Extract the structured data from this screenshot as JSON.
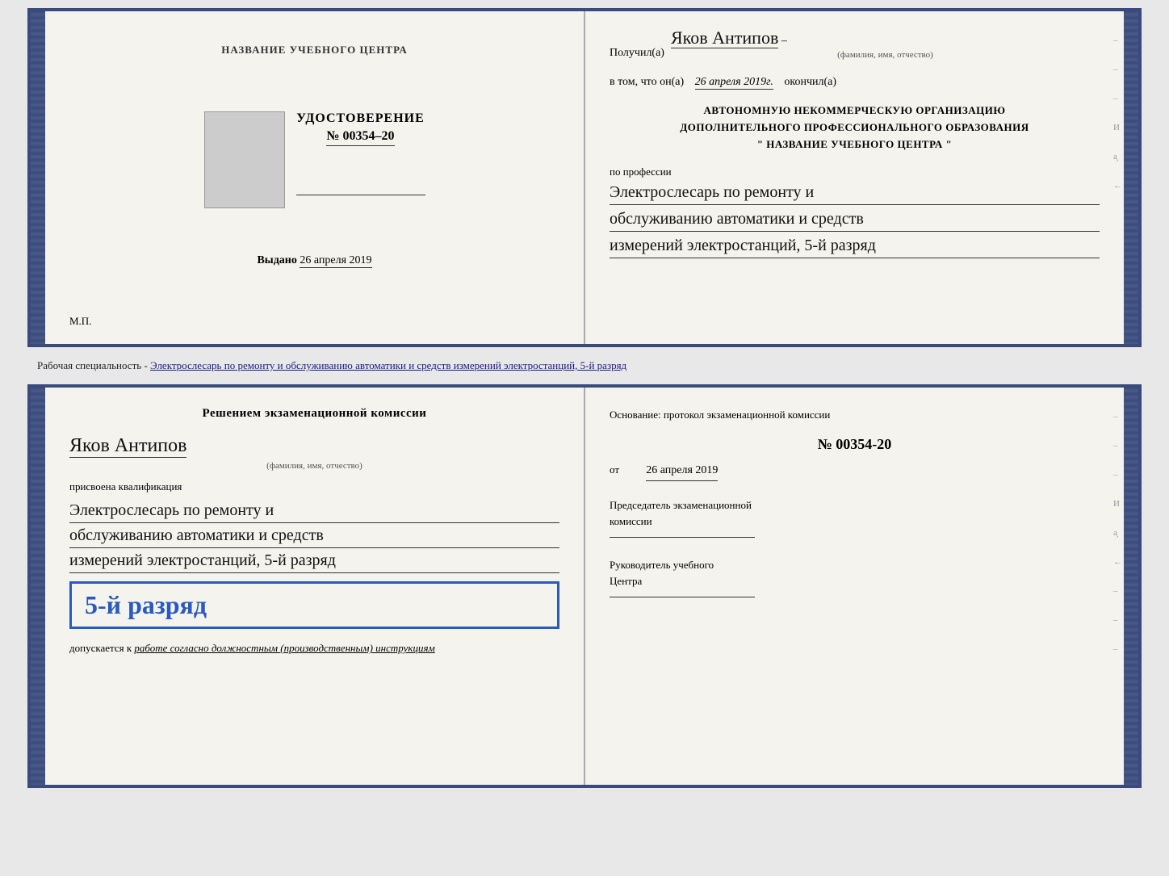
{
  "page": {
    "bg_color": "#e8e8e8"
  },
  "top_book": {
    "left_page": {
      "org_name": "НАЗВАНИЕ УЧЕБНОГО ЦЕНТРА",
      "cert_title": "УДОСТОВЕРЕНИЕ",
      "cert_number": "№ 00354–20",
      "issued_label": "Выдано",
      "issued_date": "26 апреля 2019",
      "mp_label": "М.П."
    },
    "right_page": {
      "recipient_prefix": "Получил(а)",
      "recipient_name": "Яков Антипов",
      "name_caption": "(фамилия, имя, отчество)",
      "date_prefix": "в том, что он(а)",
      "date_value": "26 апреля 2019г.",
      "date_suffix": "окончил(а)",
      "org_line1": "АВТОНОМНУЮ НЕКОММЕРЧЕСКУЮ ОРГАНИЗАЦИЮ",
      "org_line2": "ДОПОЛНИТЕЛЬНОГО ПРОФЕССИОНАЛЬНОГО ОБРАЗОВАНИЯ",
      "org_line3": "\"  НАЗВАНИЕ УЧЕБНОГО ЦЕНТРА  \"",
      "profession_label": "по профессии",
      "profession_line1": "Электрослесарь по ремонту и",
      "profession_line2": "обслуживанию автоматики и средств",
      "profession_line3": "измерений электростанций, 5-й разряд"
    }
  },
  "specialty_bar": {
    "text_start": "Рабочая специальность - ",
    "text_underlined": "Электрослесарь по ремонту и обслуживанию автоматики и средств измерений электростанций, 5-й разряд"
  },
  "bottom_book": {
    "left_page": {
      "commission_line1": "Решением экзаменационной комиссии",
      "person_name": "Яков Антипов",
      "name_caption": "(фамилия, имя, отчество)",
      "assigned_text": "присвоена квалификация",
      "qual_line1": "Электрослесарь по ремонту и",
      "qual_line2": "обслуживанию автоматики и средств",
      "qual_line3": "измерений электростанций, 5-й разряд",
      "rank_text": "5-й разряд",
      "allows_prefix": "допускается к",
      "allows_underline": "работе согласно должностным (производственным) инструкциям"
    },
    "right_page": {
      "foundation_label": "Основание: протокол экзаменационной комиссии",
      "protocol_number": "№  00354-20",
      "date_prefix": "от",
      "date_value": "26 апреля 2019",
      "chairman_label1": "Председатель экзаменационной",
      "chairman_label2": "комиссии",
      "head_label1": "Руководитель учебного",
      "head_label2": "Центра"
    }
  }
}
